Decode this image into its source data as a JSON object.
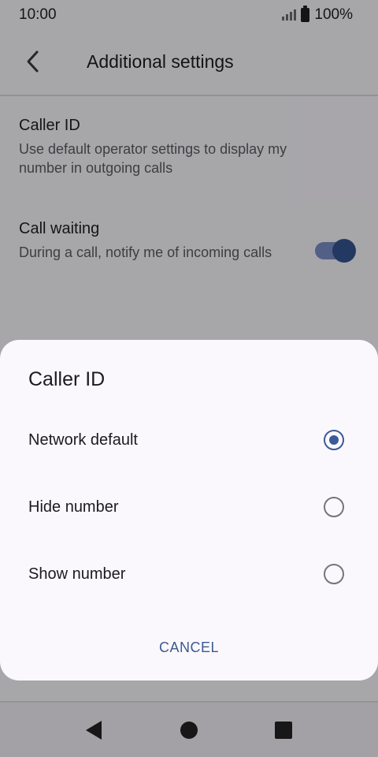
{
  "status_bar": {
    "time": "10:00",
    "battery": "100%"
  },
  "header": {
    "title": "Additional settings"
  },
  "settings": [
    {
      "title": "Caller ID",
      "summary": "Use default operator settings to display my number in outgoing calls"
    },
    {
      "title": "Call waiting",
      "summary": "During a call, notify me of incoming calls",
      "toggle_on": true
    }
  ],
  "dialog": {
    "title": "Caller ID",
    "options": [
      {
        "label": "Network default",
        "selected": true
      },
      {
        "label": "Hide number",
        "selected": false
      },
      {
        "label": "Show number",
        "selected": false
      }
    ],
    "cancel_label": "CANCEL"
  },
  "colors": {
    "accent": "#3c5a96",
    "toggle_track": "#7a8ec4",
    "dialog_bg": "#fbf8fd"
  }
}
